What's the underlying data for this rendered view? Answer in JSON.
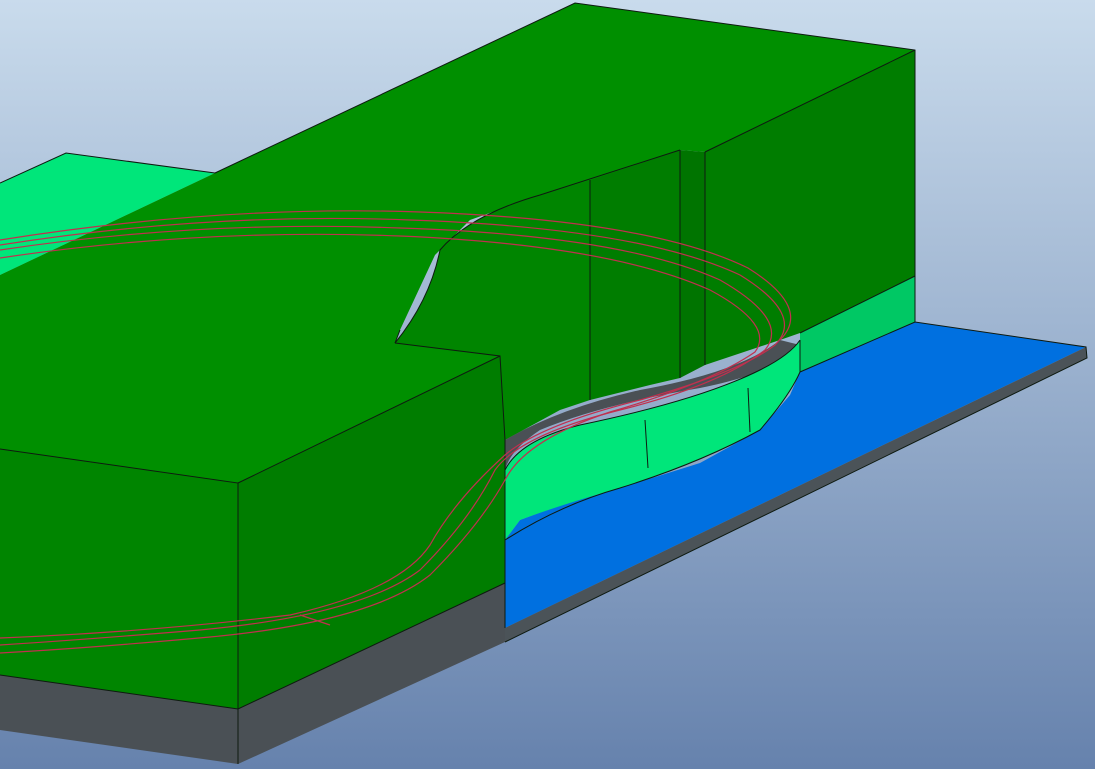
{
  "viewport": {
    "background_top": "#c9dbec",
    "background_bottom": "#6682ad"
  },
  "model": {
    "colors": {
      "solid_top": "#008f00",
      "solid_front": "#008500",
      "solid_side": "#007d00",
      "solid_darker": "#007400",
      "bright_green": "#00e67a",
      "mid_green": "#00c864",
      "plate_top": "#0070e0",
      "plate_edge": "#4b5358",
      "dark_base": "#4a5055",
      "edge_line": "#0e1a10",
      "path_curve": "#c0304e"
    }
  }
}
